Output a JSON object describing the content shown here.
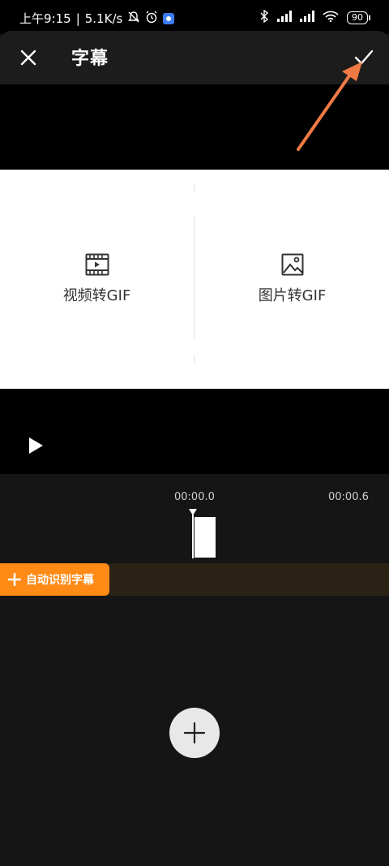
{
  "status_bar": {
    "time": "上午9:15",
    "separator": "|",
    "network_speed": "5.1K/s",
    "battery": "90",
    "icons": [
      "mute-icon",
      "alarm-icon",
      "app-icon",
      "bluetooth-icon",
      "signal-icon",
      "signal-icon",
      "wifi-icon",
      "battery-icon"
    ]
  },
  "header": {
    "title": "字幕",
    "close_icon": "close-icon",
    "confirm_icon": "check-icon"
  },
  "preview": {
    "options": [
      {
        "label": "视频转GIF",
        "icon": "film-icon"
      },
      {
        "label": "图片转GIF",
        "icon": "image-icon"
      }
    ],
    "play_icon": "play-icon"
  },
  "timeline": {
    "time_start": "00:00.0",
    "time_next": "00:00.6"
  },
  "subtitle_track": {
    "auto_recognize_label": "自动识别字幕",
    "add_icon": "plus-icon"
  },
  "colors": {
    "accent": "#ff8a16",
    "annotation_arrow": "#f07a45"
  }
}
